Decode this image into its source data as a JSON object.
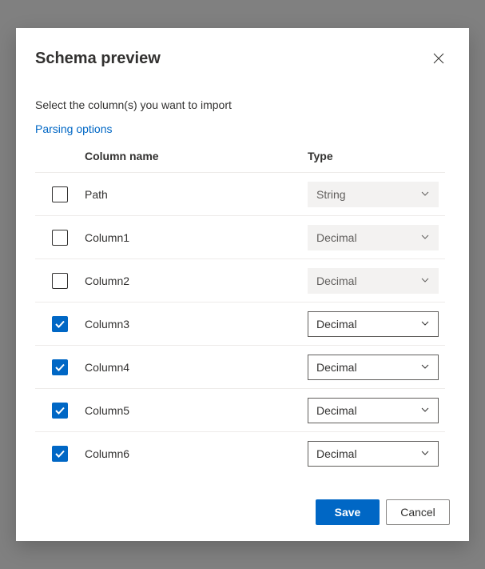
{
  "dialog": {
    "title": "Schema preview",
    "subtitle": "Select the column(s) you want to import",
    "parsing_link": "Parsing options"
  },
  "table": {
    "header_name": "Column name",
    "header_type": "Type"
  },
  "rows": [
    {
      "name": "Path",
      "type": "String",
      "checked": false
    },
    {
      "name": "Column1",
      "type": "Decimal",
      "checked": false
    },
    {
      "name": "Column2",
      "type": "Decimal",
      "checked": false
    },
    {
      "name": "Column3",
      "type": "Decimal",
      "checked": true
    },
    {
      "name": "Column4",
      "type": "Decimal",
      "checked": true
    },
    {
      "name": "Column5",
      "type": "Decimal",
      "checked": true
    },
    {
      "name": "Column6",
      "type": "Decimal",
      "checked": true
    }
  ],
  "footer": {
    "save": "Save",
    "cancel": "Cancel"
  }
}
